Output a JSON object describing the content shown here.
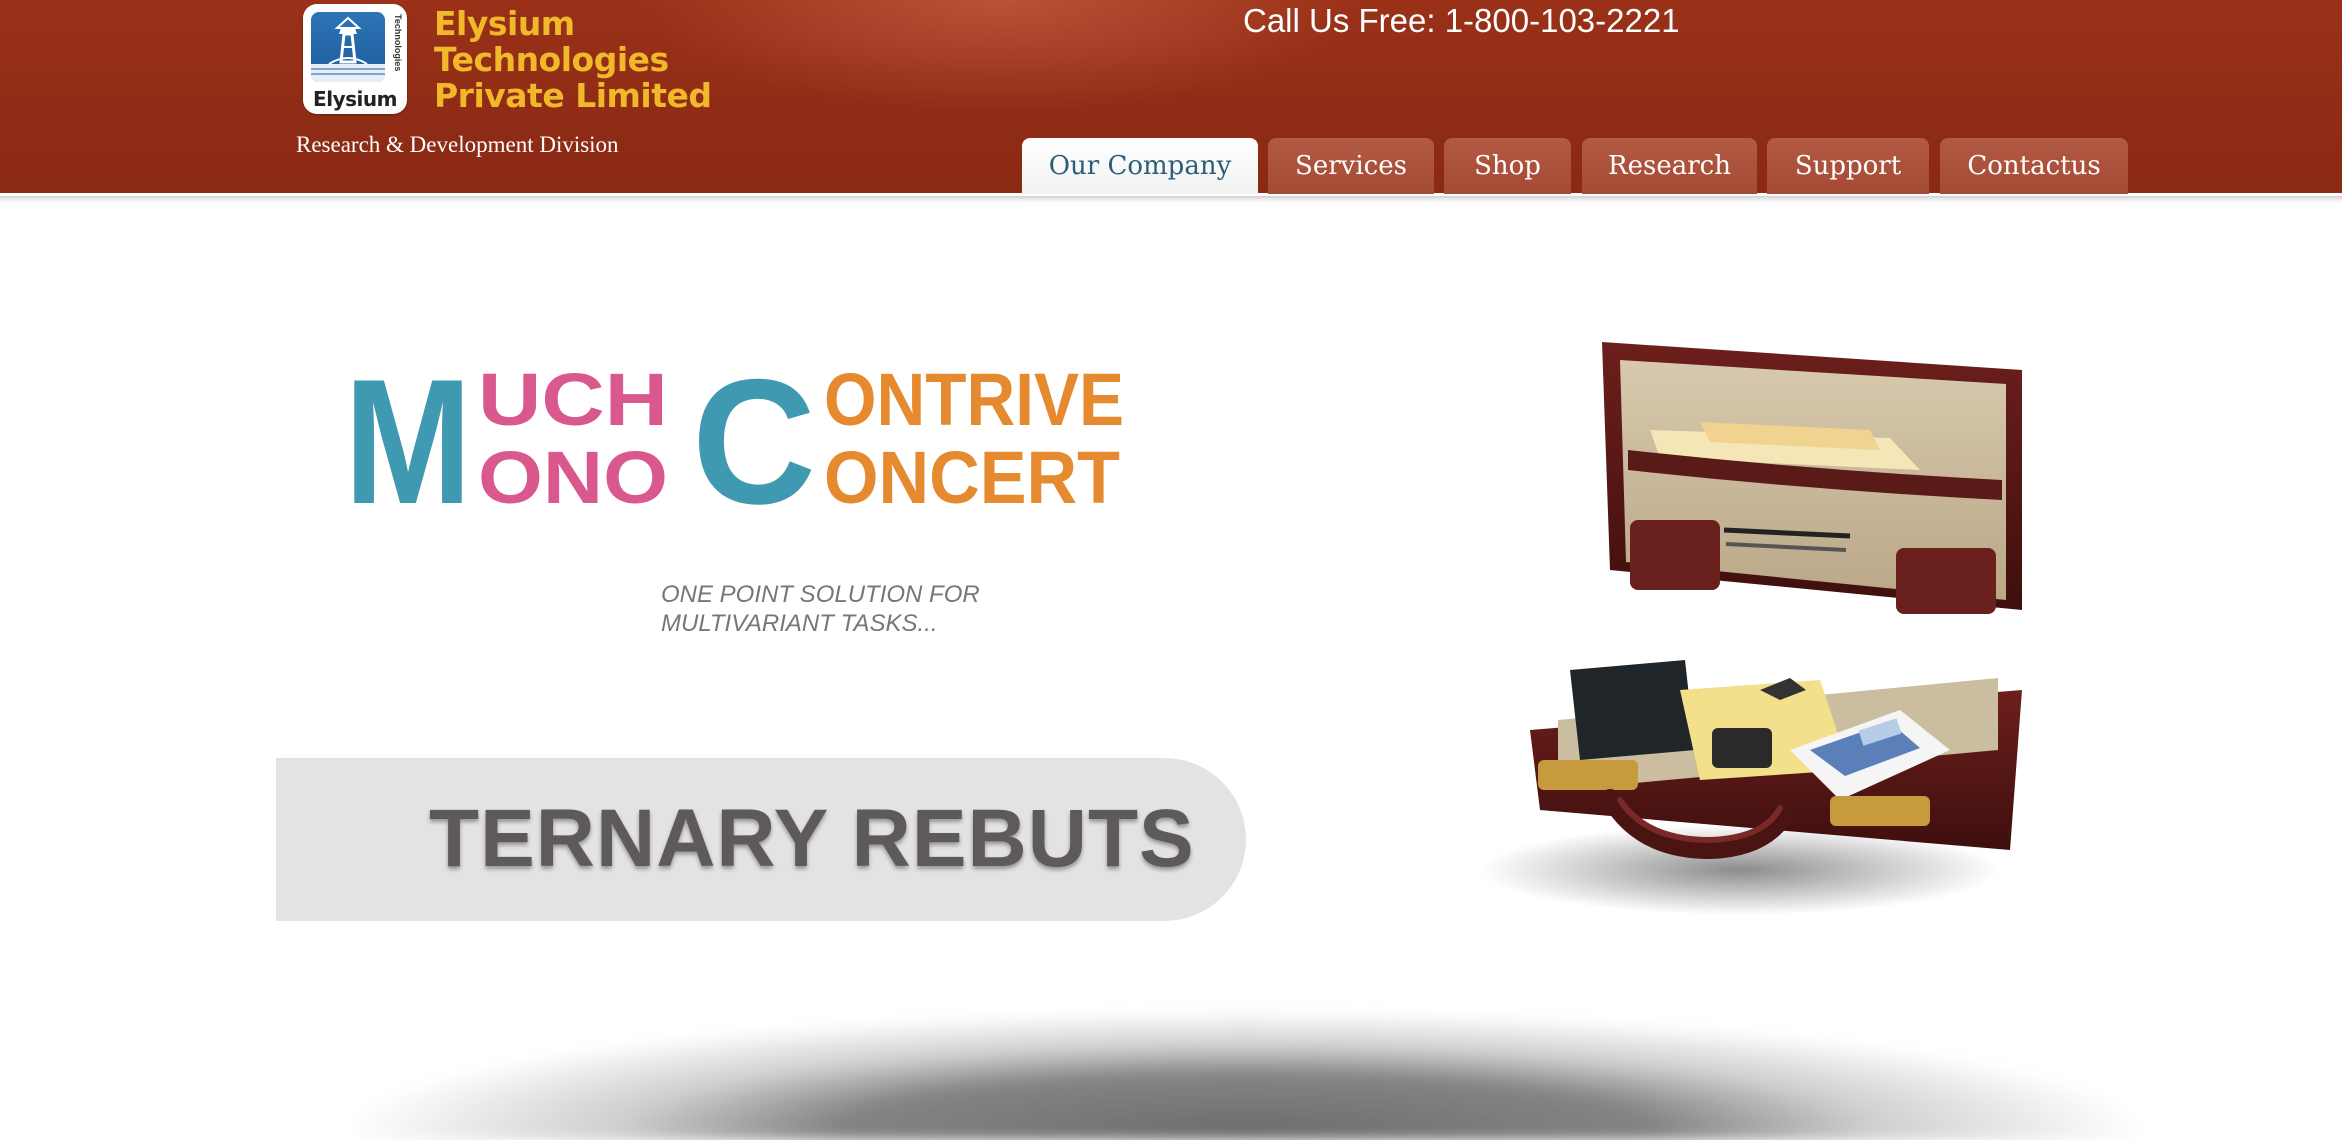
{
  "header": {
    "logo": {
      "word": "Elysium",
      "side_text": "Technologies"
    },
    "company_name": [
      "Elysium",
      "Technologies",
      "Private Limited"
    ],
    "division": "Research & Development Division",
    "call_us": "Call Us Free: 1-800-103-2221"
  },
  "nav": {
    "items": [
      {
        "label": "Our Company",
        "active": true
      },
      {
        "label": "Services",
        "active": false
      },
      {
        "label": "Shop",
        "active": false
      },
      {
        "label": "Research",
        "active": false
      },
      {
        "label": "Support",
        "active": false
      },
      {
        "label": "Contactus",
        "active": false
      }
    ]
  },
  "hero": {
    "title_left": {
      "big_letter": "M",
      "line1": "UCH",
      "line2": "ONO"
    },
    "title_right": {
      "big_letter": "C",
      "line1": "ONTRIVE",
      "line2": "ONCERT"
    },
    "tagline": [
      "ONE POINT SOLUTION FOR",
      "MULTIVARIANT TASKS..."
    ],
    "banner_text": "TERNARY REBUTS",
    "image": "open-briefcase-illustration"
  },
  "colors": {
    "header_bg": "#962f17",
    "company_name": "#f0b92a",
    "nav_active_text": "#2d5e79",
    "teal": "#3f99b1",
    "pink": "#d9598f",
    "orange": "#e58a2e"
  }
}
